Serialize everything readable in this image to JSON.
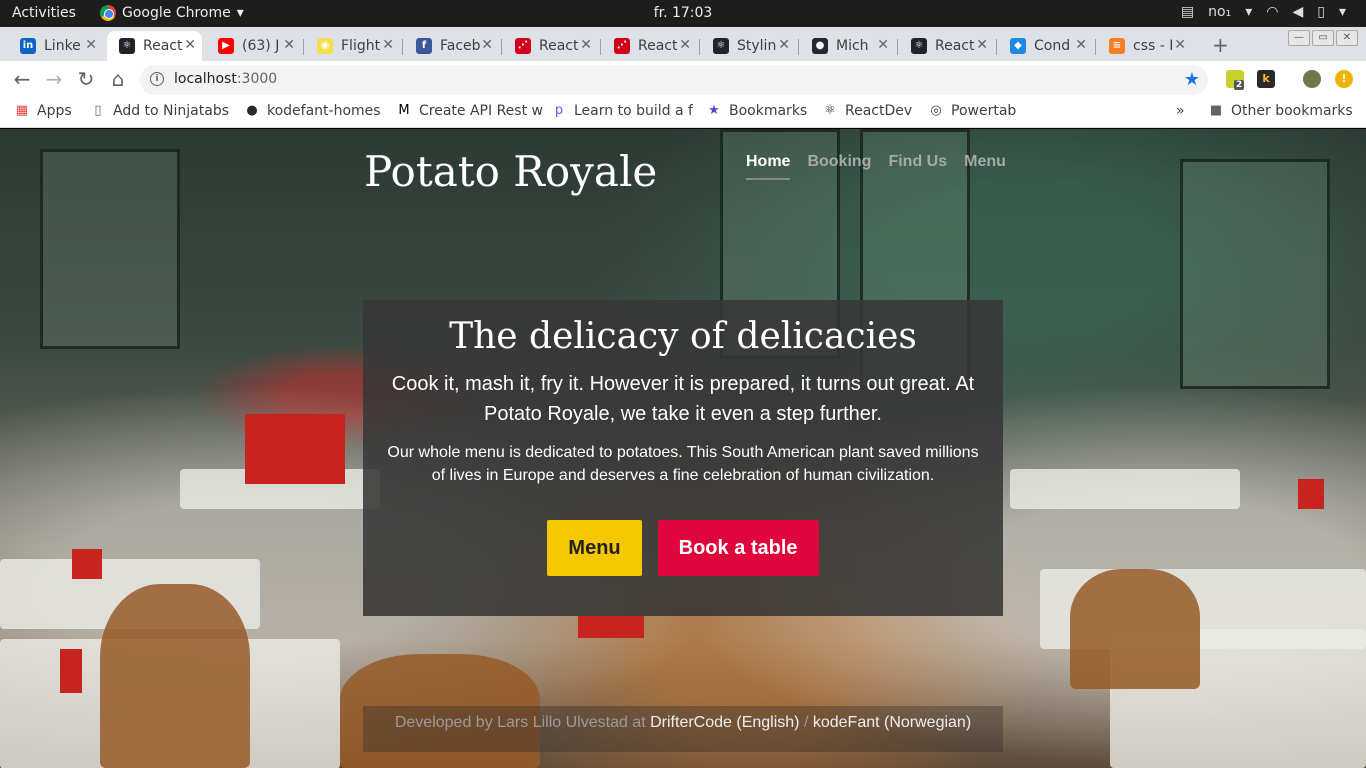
{
  "system_bar": {
    "activities": "Activities",
    "app_name": "Google Chrome",
    "app_menu_arrow": "▾",
    "clock": "fr. 17:03",
    "keyboard_layout": "no₁",
    "tray_arrow": "▾"
  },
  "tabs": [
    {
      "title": "Linke",
      "icon": "linkedin-icon",
      "color": "#0a66c2"
    },
    {
      "title": "React",
      "icon": "react-icon",
      "color": "#20232a",
      "active": true
    },
    {
      "title": "(63) J",
      "icon": "youtube-icon",
      "color": "#ff0000"
    },
    {
      "title": "Flight",
      "icon": "lightbulb-icon",
      "color": "#f4e04d"
    },
    {
      "title": "Faceb",
      "icon": "facebook-icon",
      "color": "#3b5998"
    },
    {
      "title": "React",
      "icon": "react-router-icon",
      "color": "#d0021b"
    },
    {
      "title": "React",
      "icon": "react-router-icon",
      "color": "#d0021b"
    },
    {
      "title": "Stylin",
      "icon": "react-icon",
      "color": "#20232a"
    },
    {
      "title": "Mich",
      "icon": "github-icon",
      "color": "#24292e"
    },
    {
      "title": "React",
      "icon": "react-icon",
      "color": "#20232a"
    },
    {
      "title": "Cond",
      "icon": "conda-icon",
      "color": "#1e88e5"
    },
    {
      "title": "css - I",
      "icon": "stackoverflow-icon",
      "color": "#f48024"
    }
  ],
  "tab_close": "✕",
  "new_tab": "+",
  "window_controls": {
    "minimize": "—",
    "restore": "▭",
    "close": "✕"
  },
  "toolbar": {
    "url_host": "localhost",
    "url_port": ":3000",
    "info_glyph": "i",
    "star_glyph": "★",
    "ext1_badge": "2",
    "ext2_label": "k",
    "alert_glyph": "!"
  },
  "bookmarks": [
    {
      "label": "Apps",
      "icon": "apps-grid-icon"
    },
    {
      "label": "Add to Ninjatabs",
      "icon": "page-icon"
    },
    {
      "label": "kodefant-homes",
      "icon": "github-icon"
    },
    {
      "label": "Create API Rest w",
      "icon": "medium-icon"
    },
    {
      "label": "Learn to build a f",
      "icon": "p-logo-icon"
    },
    {
      "label": "Bookmarks",
      "icon": "star-icon"
    },
    {
      "label": "ReactDev",
      "icon": "react-icon"
    },
    {
      "label": "Powertab",
      "icon": "powertab-icon"
    }
  ],
  "bookmarks_overflow": "»",
  "other_bookmarks": "Other bookmarks",
  "site": {
    "title": "Potato Royale",
    "nav": [
      "Home",
      "Booking",
      "Find Us",
      "Menu"
    ],
    "hero_heading": "The delicacy of delicacies",
    "hero_lead": "Cook it, mash it, fry it. However it is prepared, it turns out great. At Potato Royale, we take it even a step further.",
    "hero_body": "Our whole menu is dedicated to potatoes. This South American plant saved millions of lives in Europe and deserves a fine celebration of human civilization.",
    "btn_menu": "Menu",
    "btn_book": "Book a table",
    "footer_prefix": "Developed by Lars Lillo Ulvestad at",
    "footer_link1": "DrifterCode (English)",
    "footer_sep": "/",
    "footer_link2": "kodeFant (Norwegian)"
  },
  "colors": {
    "menu_button": "#f5c800",
    "book_button": "#e0053a",
    "star": "#1a73e8"
  }
}
